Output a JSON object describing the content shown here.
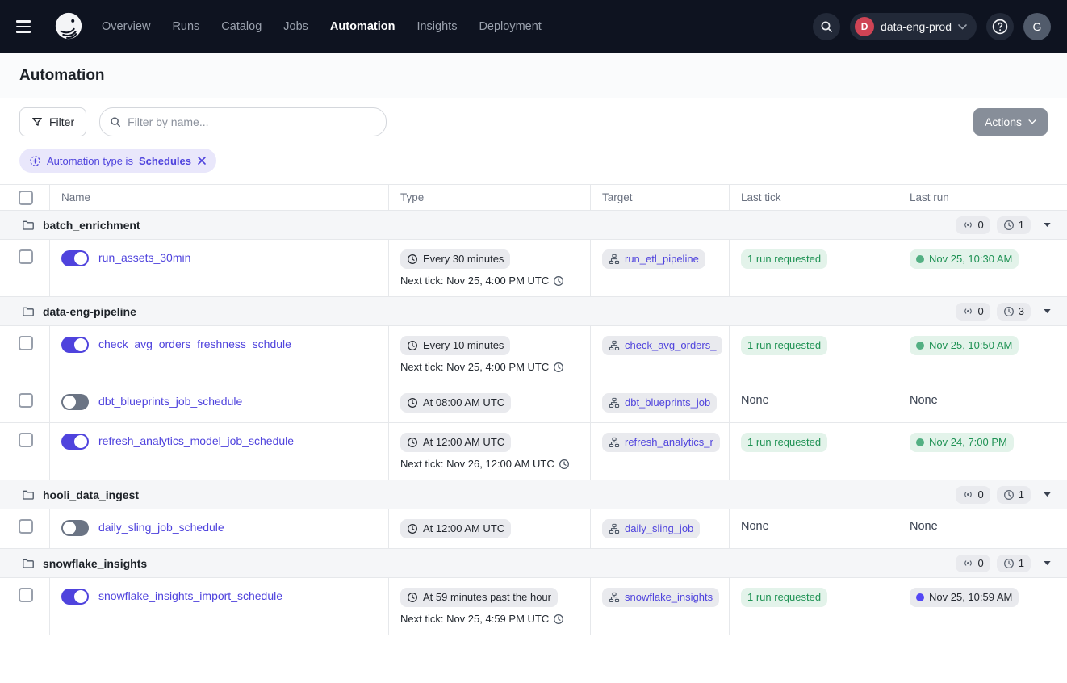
{
  "nav": {
    "items": [
      {
        "label": "Overview",
        "active": false
      },
      {
        "label": "Runs",
        "active": false
      },
      {
        "label": "Catalog",
        "active": false
      },
      {
        "label": "Jobs",
        "active": false
      },
      {
        "label": "Automation",
        "active": true
      },
      {
        "label": "Insights",
        "active": false
      },
      {
        "label": "Deployment",
        "active": false
      }
    ],
    "deployment": {
      "initial": "D",
      "name": "data-eng-prod"
    },
    "user_initial": "G"
  },
  "page": {
    "title": "Automation"
  },
  "toolbar": {
    "filter_label": "Filter",
    "search_placeholder": "Filter by name...",
    "actions_label": "Actions"
  },
  "filter_chip": {
    "prefix": "Automation type is",
    "value": "Schedules"
  },
  "colors": {
    "accent": "#4f43dd",
    "success_text": "#1f9254",
    "success_bg": "#e3f3ea",
    "success_dot": "#53b083",
    "in_progress_dot": "#5447f5"
  },
  "table": {
    "headers": {
      "name": "Name",
      "type": "Type",
      "target": "Target",
      "last_tick": "Last tick",
      "last_run": "Last run"
    },
    "groups": [
      {
        "name": "batch_enrichment",
        "sensor_count": "0",
        "schedule_count": "1",
        "rows": [
          {
            "name": "run_assets_30min",
            "enabled": true,
            "schedule": "Every 30 minutes",
            "next_tick": "Next tick: Nov 25, 4:00 PM UTC",
            "target": "run_etl_pipeline",
            "last_tick": "1 run requested",
            "last_run": "Nov 25, 10:30 AM",
            "last_run_status": "success"
          }
        ]
      },
      {
        "name": "data-eng-pipeline",
        "sensor_count": "0",
        "schedule_count": "3",
        "rows": [
          {
            "name": "check_avg_orders_freshness_schdule",
            "enabled": true,
            "schedule": "Every 10 minutes",
            "next_tick": "Next tick: Nov 25, 4:00 PM UTC",
            "target": "check_avg_orders_",
            "last_tick": "1 run requested",
            "last_run": "Nov 25, 10:50 AM",
            "last_run_status": "success"
          },
          {
            "name": "dbt_blueprints_job_schedule",
            "enabled": false,
            "schedule": "At 08:00 AM UTC",
            "next_tick": "",
            "target": "dbt_blueprints_job",
            "last_tick": "None",
            "last_run": "None",
            "last_run_status": "none"
          },
          {
            "name": "refresh_analytics_model_job_schedule",
            "enabled": true,
            "schedule": "At 12:00 AM UTC",
            "next_tick": "Next tick: Nov 26, 12:00 AM UTC",
            "target": "refresh_analytics_r",
            "last_tick": "1 run requested",
            "last_run": "Nov 24, 7:00 PM",
            "last_run_status": "success"
          }
        ]
      },
      {
        "name": "hooli_data_ingest",
        "sensor_count": "0",
        "schedule_count": "1",
        "rows": [
          {
            "name": "daily_sling_job_schedule",
            "enabled": false,
            "schedule": "At 12:00 AM UTC",
            "next_tick": "",
            "target": "daily_sling_job",
            "last_tick": "None",
            "last_run": "None",
            "last_run_status": "none"
          }
        ]
      },
      {
        "name": "snowflake_insights",
        "sensor_count": "0",
        "schedule_count": "1",
        "rows": [
          {
            "name": "snowflake_insights_import_schedule",
            "enabled": true,
            "schedule": "At 59 minutes past the hour",
            "next_tick": "Next tick: Nov 25, 4:59 PM UTC",
            "target": "snowflake_insights",
            "last_tick": "1 run requested",
            "last_run": "Nov 25, 10:59 AM",
            "last_run_status": "in_progress"
          }
        ]
      }
    ]
  }
}
